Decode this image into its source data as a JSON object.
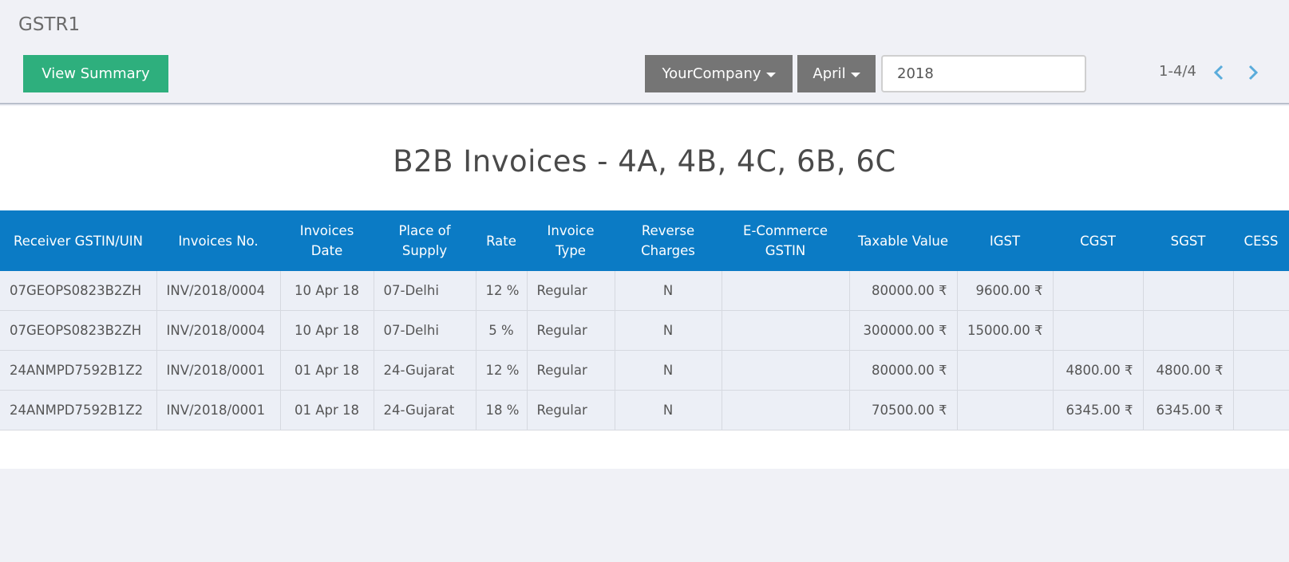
{
  "breadcrumb": "GSTR1",
  "buttons": {
    "view_summary": "View Summary"
  },
  "filters": {
    "company": "YourCompany",
    "month": "April",
    "year": "2018"
  },
  "pager": {
    "value": "1-4/4",
    "prev_icon": "chevron-left-icon",
    "next_icon": "chevron-right-icon"
  },
  "colors": {
    "primary_button": "#2eaf7d",
    "dropdown_button": "#757575",
    "table_header": "#0b7bc5",
    "link": "#2a6fb0"
  },
  "report": {
    "title": "B2B Invoices - 4A, 4B, 4C, 6B, 6C",
    "columns": [
      "Receiver GSTIN/UIN",
      "Invoices No.",
      "Invoices Date",
      "Place of Supply",
      "Rate",
      "Invoice Type",
      "Reverse Charges",
      "E-Commerce GSTIN",
      "Taxable Value",
      "IGST",
      "CGST",
      "SGST",
      "CESS"
    ],
    "rows": [
      {
        "gstin": "07GEOPS0823B2ZH",
        "invoice_no": "INV/2018/0004",
        "date": "10 Apr 18",
        "place": "07-Delhi",
        "rate": "12 %",
        "type": "Regular",
        "reverse": "N",
        "ecommerce": "",
        "taxable": "80000.00 ₹",
        "igst": "9600.00 ₹",
        "cgst": "",
        "sgst": "",
        "cess": ""
      },
      {
        "gstin": "07GEOPS0823B2ZH",
        "invoice_no": "INV/2018/0004",
        "date": "10 Apr 18",
        "place": "07-Delhi",
        "rate": "5 %",
        "type": "Regular",
        "reverse": "N",
        "ecommerce": "",
        "taxable": "300000.00 ₹",
        "igst": "15000.00 ₹",
        "cgst": "",
        "sgst": "",
        "cess": ""
      },
      {
        "gstin": "24ANMPD7592B1Z2",
        "invoice_no": "INV/2018/0001",
        "date": "01 Apr 18",
        "place": "24-Gujarat",
        "rate": "12 %",
        "type": "Regular",
        "reverse": "N",
        "ecommerce": "",
        "taxable": "80000.00 ₹",
        "igst": "",
        "cgst": "4800.00 ₹",
        "sgst": "4800.00 ₹",
        "cess": ""
      },
      {
        "gstin": "24ANMPD7592B1Z2",
        "invoice_no": "INV/2018/0001",
        "date": "01 Apr 18",
        "place": "24-Gujarat",
        "rate": "18 %",
        "type": "Regular",
        "reverse": "N",
        "ecommerce": "",
        "taxable": "70500.00 ₹",
        "igst": "",
        "cgst": "6345.00 ₹",
        "sgst": "6345.00 ₹",
        "cess": ""
      }
    ]
  }
}
